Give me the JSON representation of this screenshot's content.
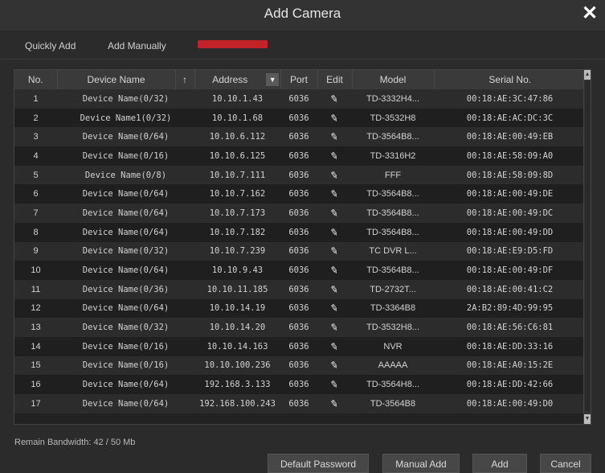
{
  "dialog": {
    "title": "Add Camera"
  },
  "tabs": [
    {
      "label": "Quickly Add"
    },
    {
      "label": "Add Manually"
    }
  ],
  "table": {
    "headers": {
      "no": "No.",
      "device_name": "Device Name",
      "address": "Address",
      "port": "Port",
      "edit": "Edit",
      "model": "Model",
      "serial": "Serial No."
    },
    "rows": [
      {
        "no": "1",
        "name": "Device Name(0/32)",
        "address": "10.10.1.43",
        "port": "6036",
        "model": "TD-3332H4...",
        "serial": "00:18:AE:3C:47:86"
      },
      {
        "no": "2",
        "name": "Device Name1(0/32)",
        "address": "10.10.1.68",
        "port": "6036",
        "model": "TD-3532H8",
        "serial": "00:18:AE:AC:DC:3C"
      },
      {
        "no": "3",
        "name": "Device Name(0/64)",
        "address": "10.10.6.112",
        "port": "6036",
        "model": "TD-3564B8...",
        "serial": "00:18:AE:00:49:EB"
      },
      {
        "no": "4",
        "name": "Device Name(0/16)",
        "address": "10.10.6.125",
        "port": "6036",
        "model": "TD-3316H2",
        "serial": "00:18:AE:58:09:A0"
      },
      {
        "no": "5",
        "name": "Device Name(0/8)",
        "address": "10.10.7.111",
        "port": "6036",
        "model": "FFF",
        "serial": "00:18:AE:58:09:8D"
      },
      {
        "no": "6",
        "name": "Device Name(0/64)",
        "address": "10.10.7.162",
        "port": "6036",
        "model": "TD-3564B8...",
        "serial": "00:18:AE:00:49:DE"
      },
      {
        "no": "7",
        "name": "Device Name(0/64)",
        "address": "10.10.7.173",
        "port": "6036",
        "model": "TD-3564B8...",
        "serial": "00:18:AE:00:49:DC"
      },
      {
        "no": "8",
        "name": "Device Name(0/64)",
        "address": "10.10.7.182",
        "port": "6036",
        "model": "TD-3564B8...",
        "serial": "00:18:AE:00:49:DD"
      },
      {
        "no": "9",
        "name": "Device Name(0/32)",
        "address": "10.10.7.239",
        "port": "6036",
        "model": "TC DVR L...",
        "serial": "00:18:AE:E9:D5:FD"
      },
      {
        "no": "10",
        "name": "Device Name(0/64)",
        "address": "10.10.9.43",
        "port": "6036",
        "model": "TD-3564B8...",
        "serial": "00:18:AE:00:49:DF"
      },
      {
        "no": "11",
        "name": "Device Name(0/36)",
        "address": "10.10.11.185",
        "port": "6036",
        "model": "TD-2732T...",
        "serial": "00:18:AE:00:41:C2"
      },
      {
        "no": "12",
        "name": "Device Name(0/64)",
        "address": "10.10.14.19",
        "port": "6036",
        "model": "TD-3364B8",
        "serial": "2A:B2:89:4D:99:95"
      },
      {
        "no": "13",
        "name": "Device Name(0/32)",
        "address": "10.10.14.20",
        "port": "6036",
        "model": "TD-3532H8...",
        "serial": "00:18:AE:56:C6:81"
      },
      {
        "no": "14",
        "name": "Device Name(0/16)",
        "address": "10.10.14.163",
        "port": "6036",
        "model": "NVR",
        "serial": "00:18:AE:DD:33:16"
      },
      {
        "no": "15",
        "name": "Device Name(0/16)",
        "address": "10.10.100.236",
        "port": "6036",
        "model": "AAAAA",
        "serial": "00:18:AE:A0:15:2E"
      },
      {
        "no": "16",
        "name": "Device Name(0/64)",
        "address": "192.168.3.133",
        "port": "6036",
        "model": "TD-3564H8...",
        "serial": "00:18:AE:DD:42:66"
      },
      {
        "no": "17",
        "name": "Device Name(0/64)",
        "address": "192.168.100.243",
        "port": "6036",
        "model": "TD-3564B8",
        "serial": "00:18:AE:00:49:D0"
      }
    ]
  },
  "status": {
    "bandwidth": "Remain Bandwidth: 42 / 50 Mb"
  },
  "buttons": {
    "default_password": "Default Password",
    "manual_add": "Manual Add",
    "add": "Add",
    "cancel": "Cancel"
  },
  "icons": {
    "close": "close-icon",
    "sort": "sort-ascending-icon",
    "filter": "chevron-down-icon",
    "edit": "pencil-icon"
  }
}
